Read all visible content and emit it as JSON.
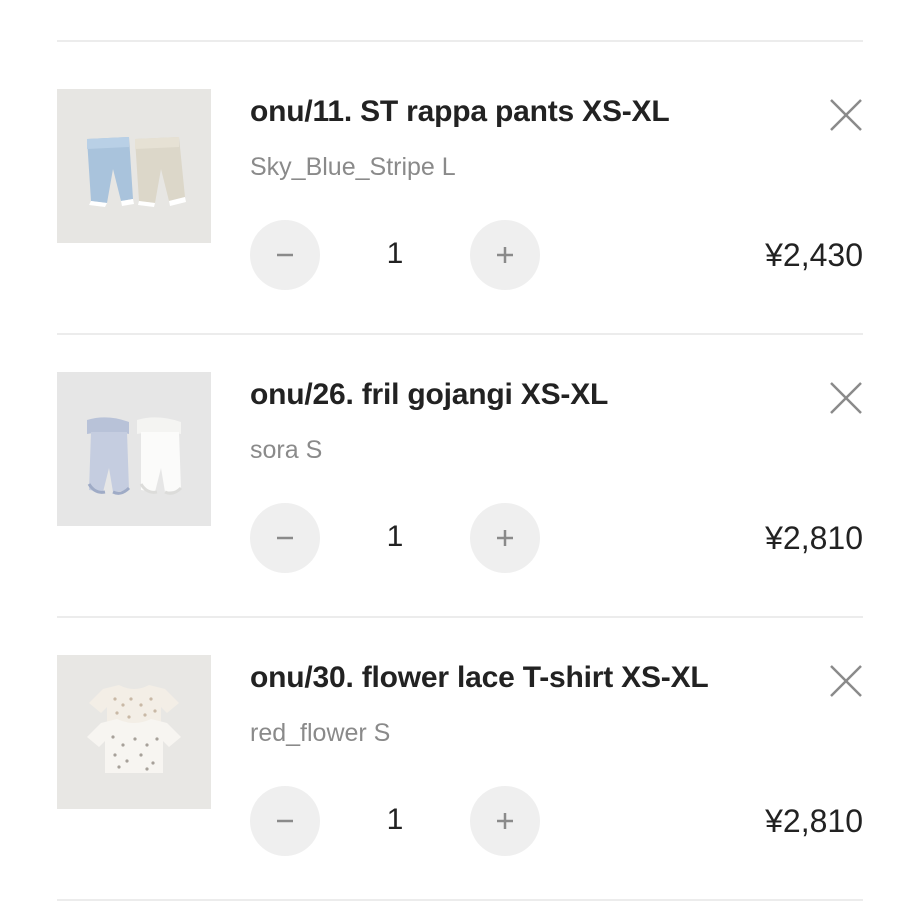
{
  "cart": {
    "items": [
      {
        "title": "onu/11. ST rappa pants XS-XL",
        "variant": "Sky_Blue_Stripe L",
        "quantity": "1",
        "price": "¥2,430",
        "image_icon": "pants-product-photo"
      },
      {
        "title": "onu/26. fril gojangi XS-XL",
        "variant": "sora S",
        "quantity": "1",
        "price": "¥2,810",
        "image_icon": "romper-product-photo"
      },
      {
        "title": "onu/30. flower lace T-shirt XS-XL",
        "variant": "red_flower S",
        "quantity": "1",
        "price": "¥2,810",
        "image_icon": "tshirt-product-photo"
      }
    ],
    "controls": {
      "remove_icon": "close-icon",
      "decrease_icon": "minus-icon",
      "increase_icon": "plus-icon"
    },
    "colors": {
      "text": "#222222",
      "muted": "#8a8a8a",
      "button_bg": "#efefef",
      "divider": "#ececec"
    }
  }
}
